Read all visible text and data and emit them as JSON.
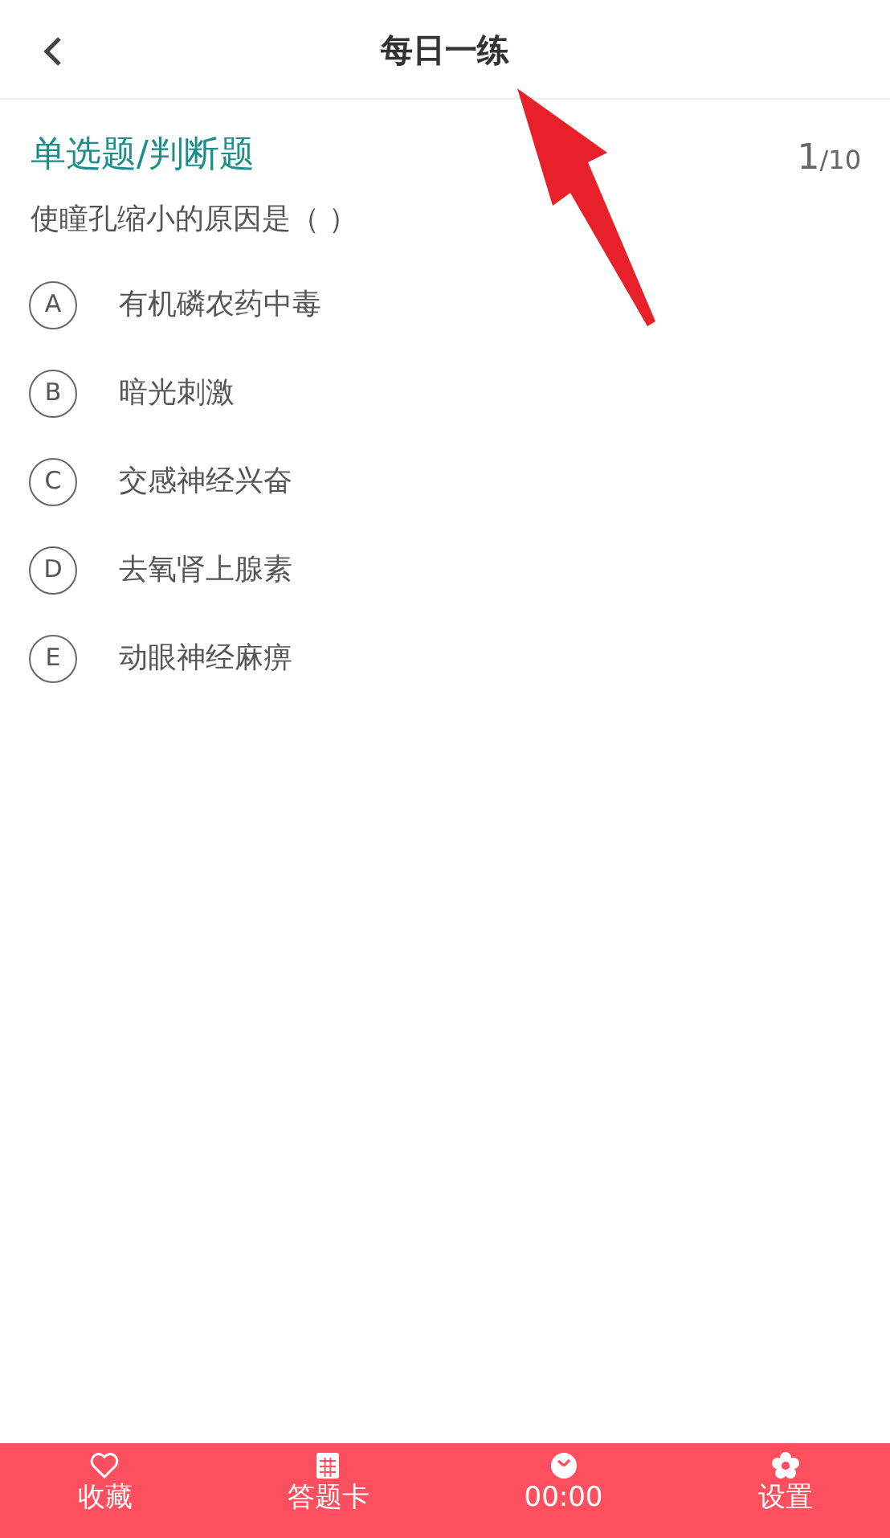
{
  "header": {
    "title": "每日一练"
  },
  "question": {
    "type": "单选题/判断题",
    "current": "1",
    "total": "/10",
    "text": "使瞳孔缩小的原因是（ ）"
  },
  "options": [
    {
      "letter": "A",
      "text": "有机磷农药中毒",
      "selected": false
    },
    {
      "letter": "B",
      "text": "暗光刺激",
      "selected": false
    },
    {
      "letter": "C",
      "text": "交感神经兴奋",
      "selected": false
    },
    {
      "letter": "D",
      "text": "去氧肾上腺素",
      "selected": false
    },
    {
      "letter": "E",
      "text": "动眼神经麻痹",
      "selected": false
    }
  ],
  "tabbar": [
    {
      "kind": "heart",
      "label": "收藏"
    },
    {
      "kind": "grid",
      "label": "答题卡"
    },
    {
      "kind": "clock",
      "label": "00:00"
    },
    {
      "kind": "gear",
      "label": "设置"
    }
  ]
}
